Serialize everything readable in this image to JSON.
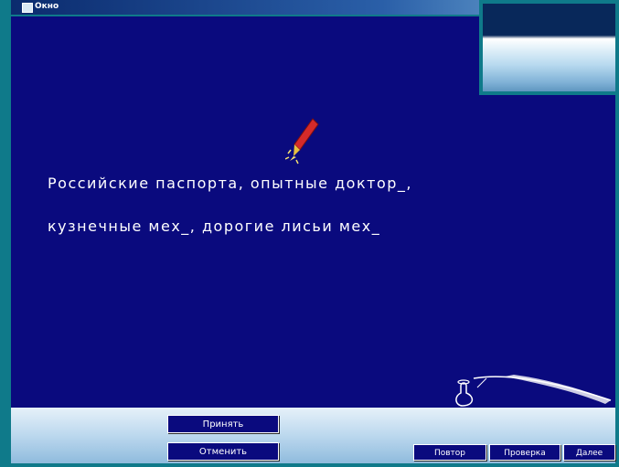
{
  "window": {
    "title": "Окно"
  },
  "task": {
    "line1": "Российские паспорта, опытные доктор_,",
    "line2": "кузнечные мех_, дорогие лисьи мех_"
  },
  "toolbar": {
    "accept_label": "Принять",
    "cancel_label": "Отменить",
    "repeat_label": "Повтор",
    "check_label": "Проверка",
    "next_label": "Далее"
  },
  "icons": {
    "pen": "pen-icon",
    "inkwell": "inkwell-icon"
  },
  "colors": {
    "workspace_bg": "#0a0a7e",
    "frame": "#0f7a8a",
    "text": "#ffffff",
    "toolbar_bg": "#bcd8ee"
  }
}
